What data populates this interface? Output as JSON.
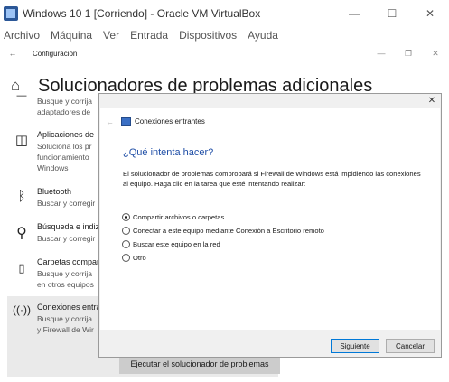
{
  "vbox": {
    "title": "Windows 10 1 [Corriendo] - Oracle VM VirtualBox",
    "controls": [
      "—",
      "☐",
      "✕"
    ],
    "menu": [
      "Archivo",
      "Máquina",
      "Ver",
      "Entrada",
      "Dispositivos",
      "Ayuda"
    ]
  },
  "settings": {
    "back": "←",
    "title": "Configuración",
    "controls": [
      "—",
      "❐",
      "✕"
    ]
  },
  "page": {
    "title": "Solucionadores de problemas adicionales",
    "run_button": "Ejecutar el solucionador de problemas"
  },
  "list": {
    "top_desc": [
      "Busque y corrija",
      "adaptadores de"
    ],
    "items": [
      {
        "title": "Aplicaciones de",
        "desc": [
          "Soluciona los pr",
          "funcionamiento",
          "Windows"
        ]
      },
      {
        "title": "Bluetooth",
        "desc": [
          "Buscar y corregir"
        ]
      },
      {
        "title": "Búsqueda e indiz",
        "desc": [
          "Buscar y corregir"
        ]
      },
      {
        "title": "Carpetas compar",
        "desc": [
          "Busque y corrija",
          "en otros equipos"
        ]
      },
      {
        "title": "Conexiones entra",
        "desc": [
          "Busque y corrija",
          "y Firewall de Wir"
        ]
      }
    ]
  },
  "dialog": {
    "close": "✕",
    "back": "←",
    "header_title": "Conexiones entrantes",
    "question": "¿Qué intenta hacer?",
    "description": "El solucionador de problemas comprobará si Firewall de Windows está impidiendo las conexiones al equipo. Haga clic en la tarea que esté intentando realizar:",
    "options": [
      {
        "label": "Compartir archivos o carpetas",
        "selected": true
      },
      {
        "label": "Conectar a este equipo mediante Conexión a Escritorio remoto",
        "selected": false
      },
      {
        "label": "Buscar este equipo en la red",
        "selected": false
      },
      {
        "label": "Otro",
        "selected": false
      }
    ],
    "next_button": "Siguiente",
    "cancel_button": "Cancelar"
  },
  "colors": {
    "accent": "#0078d7",
    "link_blue": "#1f4ea6",
    "dialog_bg": "#f0f0f0",
    "selected_item_bg": "#eaeaea"
  }
}
